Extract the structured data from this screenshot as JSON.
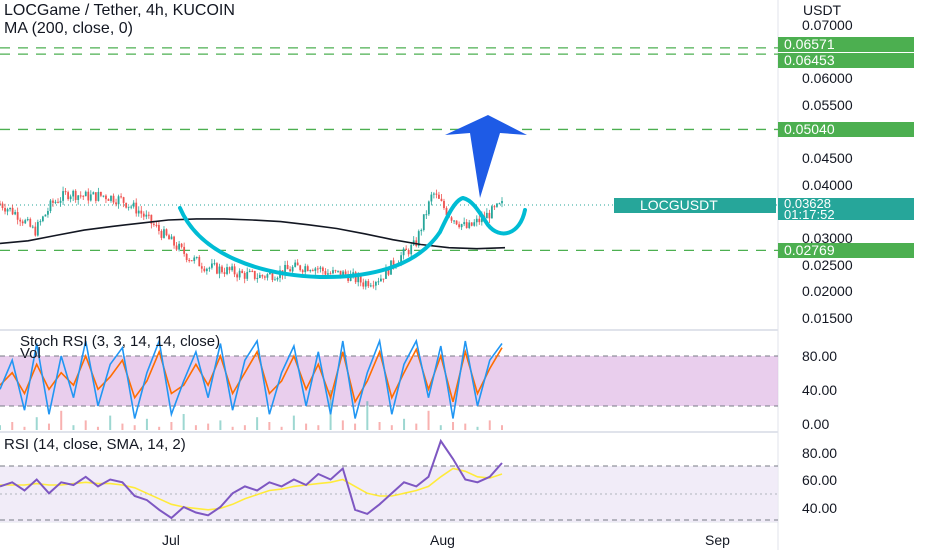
{
  "header": {
    "title": "LOCGame / Tether, 4h, KUCOIN",
    "ma_label": "MA (200, close, 0)"
  },
  "colors": {
    "green": "#4caf50",
    "teal": "#26a69a",
    "red": "#ef5350",
    "cyan": "#00bcd4",
    "arrow": "#1e5be6",
    "stoch_k": "#2196f3",
    "stoch_d": "#ff6d00",
    "rsi": "#7e57c2",
    "rsi_ma": "#ffeb3b",
    "band": "#e1bee7"
  },
  "chart_data": [
    {
      "type": "candlestick",
      "name_label": "LOCGUSDT",
      "currency": "USDT",
      "y_ticks": [
        "0.07000",
        "0.06000",
        "0.05500",
        "0.04500",
        "0.04000",
        "0.03000",
        "0.02500",
        "0.02000",
        "0.01500"
      ],
      "price_levels": [
        {
          "label": "0.06571",
          "value": 0.06571
        },
        {
          "label": "0.06453",
          "value": 0.06453
        },
        {
          "label": "0.05040",
          "value": 0.0504
        },
        {
          "label": "0.02769",
          "value": 0.02769
        }
      ],
      "last_price": {
        "label": "0.03628",
        "value": 0.03628,
        "countdown": "01:17:52"
      },
      "x_ticks": [
        "Jul",
        "Aug",
        "Sep"
      ],
      "ma200": [
        0.029,
        0.0295,
        0.0305,
        0.0315,
        0.0322,
        0.0328,
        0.0334,
        0.0336,
        0.0336,
        0.0334,
        0.0331,
        0.0325,
        0.0318,
        0.0308,
        0.0297,
        0.0288,
        0.0282,
        0.028,
        0.0282
      ],
      "close": [
        0.0365,
        0.0345,
        0.0312,
        0.0365,
        0.0385,
        0.0378,
        0.038,
        0.0372,
        0.0352,
        0.032,
        0.029,
        0.0262,
        0.0245,
        0.024,
        0.0232,
        0.0228,
        0.0234,
        0.0244,
        0.0248,
        0.0234,
        0.0232,
        0.0216,
        0.0226,
        0.0262,
        0.0288,
        0.0385,
        0.0342,
        0.0318,
        0.034,
        0.0362
      ]
    },
    {
      "type": "line",
      "title": "Stoch RSI (3, 3, 14, 14, close)",
      "overlay_label": "Vol",
      "y_ticks": [
        "80.00",
        "40.00",
        "0.00"
      ],
      "band": [
        20,
        80
      ],
      "series": [
        {
          "name": "K",
          "values": [
            40,
            75,
            15,
            95,
            10,
            80,
            30,
            98,
            20,
            70,
            90,
            5,
            60,
            98,
            10,
            50,
            85,
            30,
            95,
            15,
            75,
            98,
            10,
            60,
            92,
            20,
            85,
            10,
            98,
            5,
            60,
            98,
            10,
            70,
            98,
            30,
            92,
            5,
            98,
            20,
            75,
            95
          ]
        },
        {
          "name": "D",
          "values": [
            45,
            60,
            35,
            70,
            40,
            60,
            45,
            80,
            40,
            55,
            75,
            30,
            50,
            85,
            35,
            45,
            70,
            45,
            80,
            35,
            60,
            85,
            35,
            50,
            80,
            40,
            70,
            30,
            85,
            25,
            50,
            85,
            30,
            60,
            88,
            40,
            80,
            25,
            85,
            35,
            65,
            90
          ]
        }
      ],
      "volume": [
        3,
        5,
        2,
        8,
        4,
        12,
        3,
        6,
        2,
        9,
        4,
        3,
        7,
        2,
        5,
        10,
        3,
        4,
        6,
        2,
        3,
        8,
        5,
        2,
        9,
        4,
        3,
        25,
        6,
        4,
        18,
        5,
        3,
        7,
        4,
        12,
        3,
        5,
        4,
        2,
        6,
        3
      ]
    },
    {
      "type": "line",
      "title": "RSI (14, close, SMA, 14, 2)",
      "y_ticks": [
        "80.00",
        "60.00",
        "40.00"
      ],
      "band": [
        30,
        70
      ],
      "series": [
        {
          "name": "RSI",
          "values": [
            55,
            58,
            52,
            60,
            50,
            58,
            56,
            62,
            55,
            60,
            58,
            48,
            45,
            38,
            32,
            40,
            36,
            34,
            40,
            50,
            55,
            52,
            58,
            55,
            60,
            56,
            64,
            60,
            68,
            38,
            35,
            42,
            50,
            58,
            55,
            62,
            88,
            75,
            60,
            58,
            62,
            72
          ]
        },
        {
          "name": "RSI-MA",
          "values": [
            56,
            56,
            56,
            57,
            56,
            56,
            57,
            58,
            57,
            57,
            56,
            54,
            50,
            46,
            42,
            40,
            39,
            38,
            39,
            42,
            46,
            49,
            52,
            53,
            55,
            56,
            57,
            58,
            60,
            55,
            50,
            48,
            48,
            50,
            52,
            55,
            62,
            68,
            66,
            62,
            61,
            64
          ]
        }
      ]
    }
  ]
}
